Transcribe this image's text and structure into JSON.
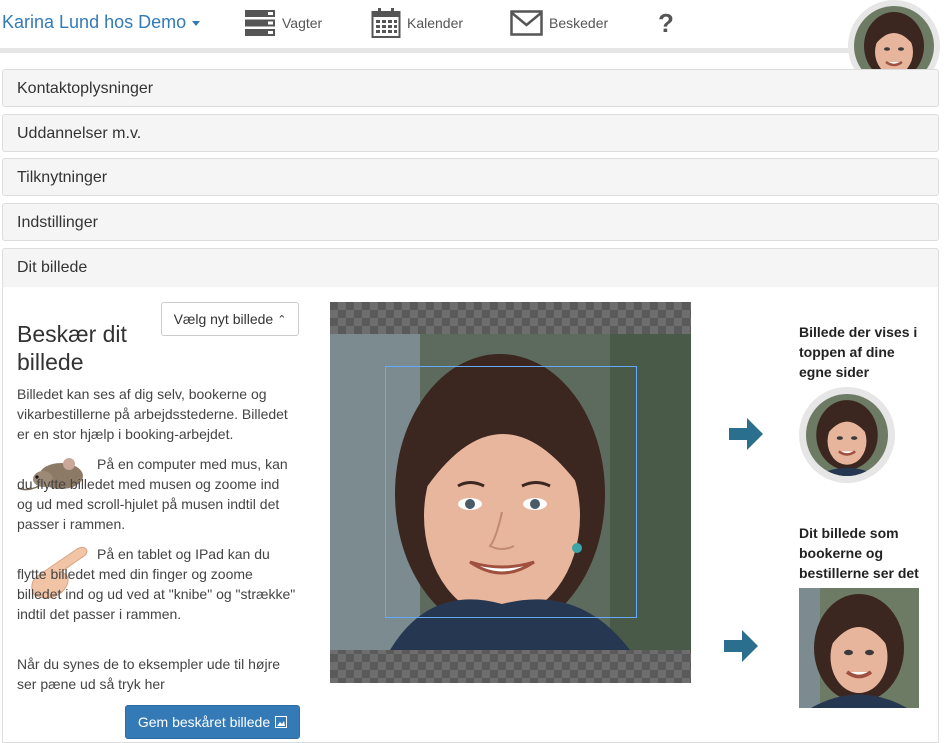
{
  "header": {
    "user_menu": "Karina Lund hos Demo",
    "nav": [
      {
        "label": "Vagter",
        "icon": "shifts-icon"
      },
      {
        "label": "Kalender",
        "icon": "calendar-icon"
      },
      {
        "label": "Beskeder",
        "icon": "envelope-icon"
      },
      {
        "label": "",
        "icon": "help-icon"
      }
    ],
    "help_glyph": "?"
  },
  "panels": [
    {
      "title": "Kontaktoplysninger"
    },
    {
      "title": "Uddannelser m.v."
    },
    {
      "title": "Tilknytninger"
    },
    {
      "title": "Indstillinger"
    },
    {
      "title": "Dit billede"
    }
  ],
  "crop": {
    "heading": "Beskær dit billede",
    "choose_button": "Vælg nyt billede",
    "intro": "Billedet kan ses af dig selv, bookerne og vikarbestillerne på arbejdsstederne. Billedet er en stor hjælp i booking-arbejdet.",
    "mouse_text": "På en computer med mus, kan du flytte billedet med musen og zoome ind og ud med scroll-hjulet på musen indtil det passer i rammen.",
    "tablet_text": "På en tablet og IPad kan du flytte billedet med din finger og zoome billedet ind og ud ved at \"knibe\" og \"strække\" indtil det passer i rammen.",
    "final_text": "Når du synes de to eksempler ude til højre ser pæne ud så tryk her",
    "save_button": "Gem beskåret billede",
    "preview_top_label": "Billede der vises i toppen af dine egne sider",
    "preview_booker_label": "Dit billede som bookerne og bestillerne ser det"
  },
  "colors": {
    "accent": "#337ab7",
    "arrow": "#2a6f8e"
  }
}
